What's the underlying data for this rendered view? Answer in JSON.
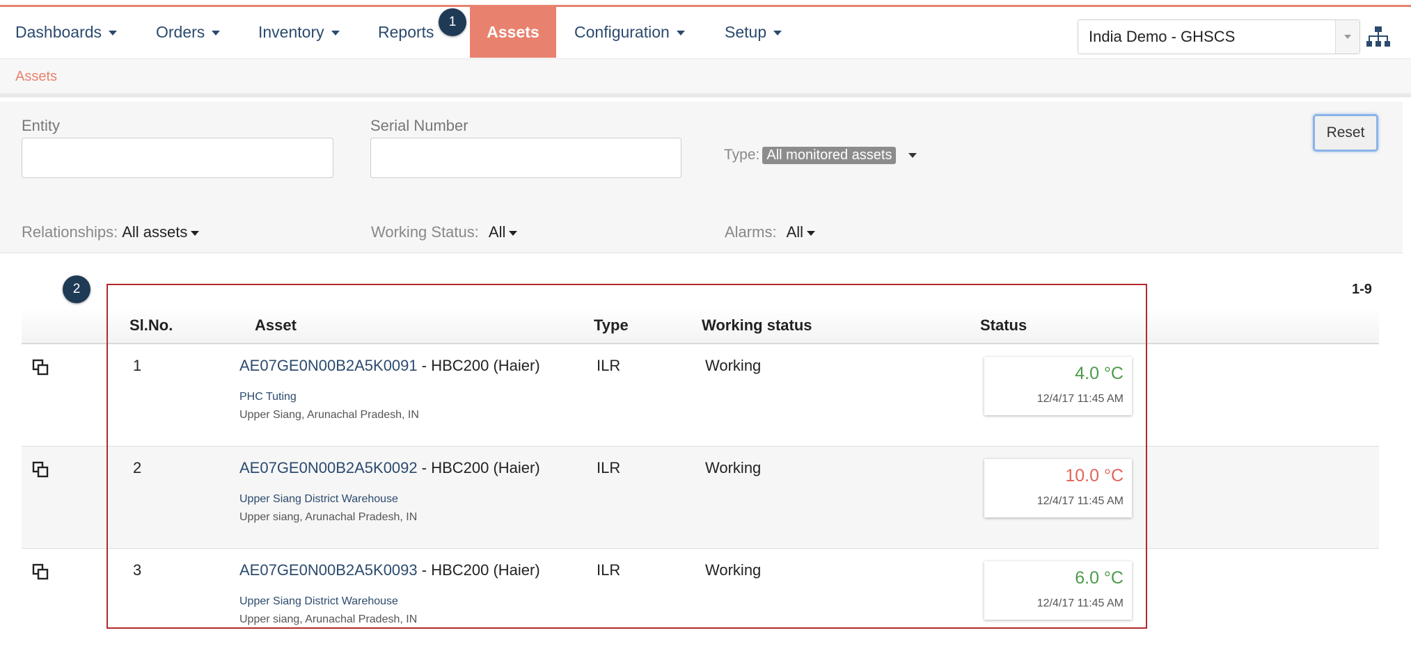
{
  "nav": {
    "items": [
      {
        "label": "Dashboards",
        "dropdown": true
      },
      {
        "label": "Orders",
        "dropdown": true
      },
      {
        "label": "Inventory",
        "dropdown": true
      },
      {
        "label": "Reports",
        "dropdown": false
      },
      {
        "label": "Assets",
        "active": true
      },
      {
        "label": "Configuration",
        "dropdown": true
      },
      {
        "label": "Setup",
        "dropdown": true
      }
    ],
    "entity_select": "India Demo - GHSCS",
    "hierarchy_icon": "hierarchy-icon"
  },
  "callouts": {
    "one": "1",
    "two": "2"
  },
  "breadcrumb": "Assets",
  "filters": {
    "entity_label": "Entity",
    "entity_value": "",
    "serial_label": "Serial Number",
    "serial_value": "",
    "type_label": "Type:",
    "type_value": "All monitored assets",
    "reset_label": "Reset",
    "relationships_label": "Relationships:",
    "relationships_value": "All assets",
    "working_status_label": "Working Status:",
    "working_status_value": "All",
    "alarms_label": "Alarms:",
    "alarms_value": "All"
  },
  "table": {
    "range": "1-9",
    "headers": {
      "slno": "Sl.No.",
      "asset": "Asset",
      "type": "Type",
      "working": "Working status",
      "status": "Status"
    },
    "rows": [
      {
        "slno": "1",
        "asset_id": "AE07GE0N00B2A5K0091",
        "asset_model": " - HBC200 (Haier)",
        "location": "PHC Tuting",
        "region": "Upper Siang, Arunachal Pradesh, IN",
        "type": "ILR",
        "working": "Working",
        "temp": "4.0 °C",
        "temp_state": "ok",
        "time": "12/4/17 11:45 AM"
      },
      {
        "slno": "2",
        "asset_id": "AE07GE0N00B2A5K0092",
        "asset_model": " - HBC200 (Haier)",
        "location": "Upper Siang District Warehouse",
        "region": "Upper siang, Arunachal Pradesh, IN",
        "type": "ILR",
        "working": "Working",
        "temp": "10.0 °C",
        "temp_state": "alarm",
        "time": "12/4/17 11:45 AM"
      },
      {
        "slno": "3",
        "asset_id": "AE07GE0N00B2A5K0093",
        "asset_model": " - HBC200 (Haier)",
        "location": "Upper Siang District Warehouse",
        "region": "Upper siang, Arunachal Pradesh, IN",
        "type": "ILR",
        "working": "Working",
        "temp": "6.0 °C",
        "temp_state": "ok",
        "time": "12/4/17 11:45 AM"
      }
    ]
  },
  "colors": {
    "accent": "#e8826f",
    "link": "#2b4a6e",
    "temp_ok": "#4c9a4a",
    "temp_alarm": "#e0655a",
    "callout": "#1f3a55",
    "highlight": "#b22a2a"
  }
}
